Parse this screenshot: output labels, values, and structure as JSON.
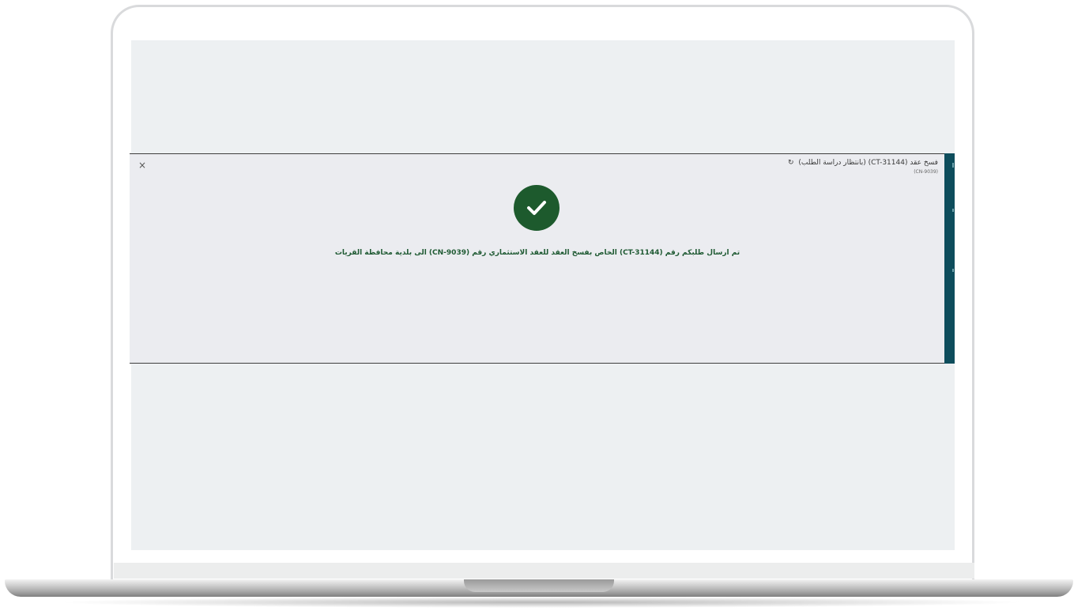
{
  "modal": {
    "title": "فسخ عقد (CT-31144) (بانتظار دراسة الطلب)",
    "reference": "(CN-9039)",
    "close_label": "×",
    "message": "تم ارسال طلبكم رقم (CT-31144) الخاص بفسخ العقد للعقد الاستثماري رقم (CN-9039) الى بلدية محافظة القريات",
    "success_icon": "check-circle-icon",
    "refresh_icon": "refresh-icon"
  },
  "colors": {
    "success_green": "#1d5a2d",
    "message_green": "#1f5a33",
    "side_panel": "#0e4d5c",
    "screen_background": "#edf0f2",
    "modal_background": "#ebecf0"
  }
}
